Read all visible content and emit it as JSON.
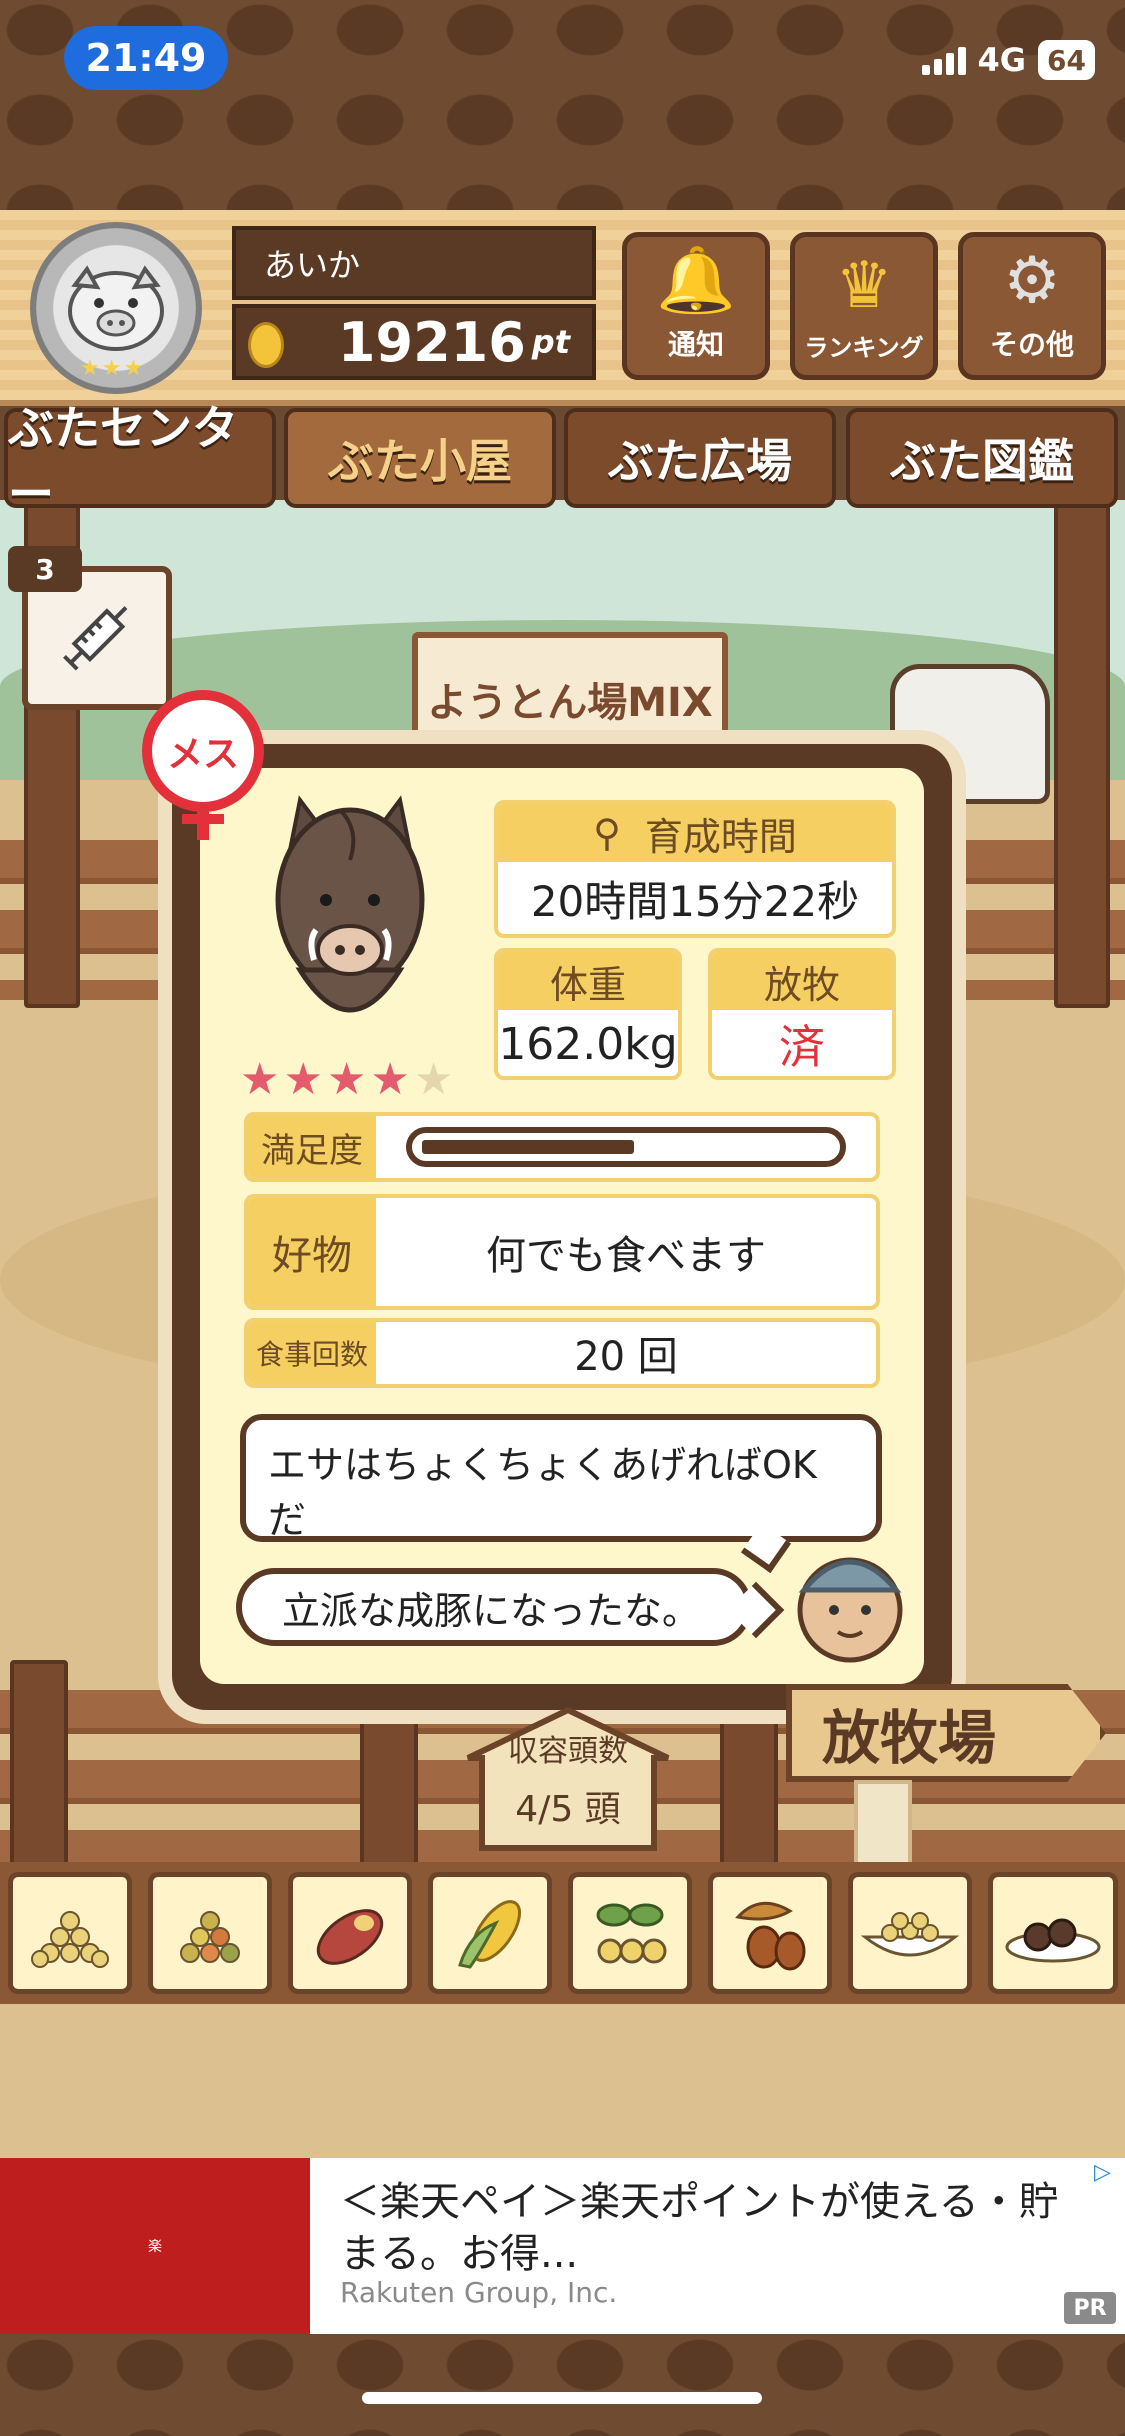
{
  "status_bar": {
    "time": "21:49",
    "network": "4G",
    "battery": "64"
  },
  "header": {
    "user_name": "あいか",
    "points": "19216",
    "points_unit": "pt",
    "buttons": [
      {
        "label": "通知",
        "icon": "bell-icon"
      },
      {
        "label": "ランキング",
        "icon": "crown-icon"
      },
      {
        "label": "その他",
        "icon": "gear-icon"
      }
    ]
  },
  "tabs": [
    {
      "label": "ぶたセンター"
    },
    {
      "label": "ぶた小屋"
    },
    {
      "label": "ぶた広場"
    },
    {
      "label": "ぶた図鑑"
    }
  ],
  "side_item": {
    "count": "3",
    "icon": "syringe-icon"
  },
  "sign": {
    "text": "ようとん場MIX"
  },
  "pig": {
    "gender": "メス",
    "stars_filled": 4,
    "stars_total": 5,
    "growth_time_label": "育成時間",
    "growth_time": "20時間15分22秒",
    "weight_label": "体重",
    "weight": "162.0kg",
    "grazing_label": "放牧",
    "grazing": "済",
    "satisfaction_label": "満足度",
    "satisfaction_level": 0.52,
    "favorite_label": "好物",
    "favorite": "何でも食べます",
    "meals_label": "食事回数",
    "meals": "20 回"
  },
  "dialog": {
    "tip": "エサはちょくちょくあげればOKだ",
    "comment": "立派な成豚になったな。"
  },
  "capacity": {
    "label": "収容頭数",
    "value": "4/5 頭"
  },
  "ranch_sign": "放牧場",
  "foods": [
    {
      "icon": "grain-pile-icon"
    },
    {
      "icon": "mixed-grain-icon"
    },
    {
      "icon": "sweet-potato-icon"
    },
    {
      "icon": "corn-icon"
    },
    {
      "icon": "soybean-icon"
    },
    {
      "icon": "acorn-icon"
    },
    {
      "icon": "bowl-feed-icon"
    },
    {
      "icon": "meatball-plate-icon"
    }
  ],
  "ad": {
    "title": "＜楽天ペイ＞楽天ポイントが使える・貯まる。お得...",
    "source": "Rakuten Group, Inc.",
    "badge": "PR",
    "logo": "楽"
  },
  "colors": {
    "time_pill": "#1f6cde",
    "accent_red": "#e3303b",
    "wood_dark": "#5a3a25",
    "label_yellow": "#f6cf63"
  }
}
